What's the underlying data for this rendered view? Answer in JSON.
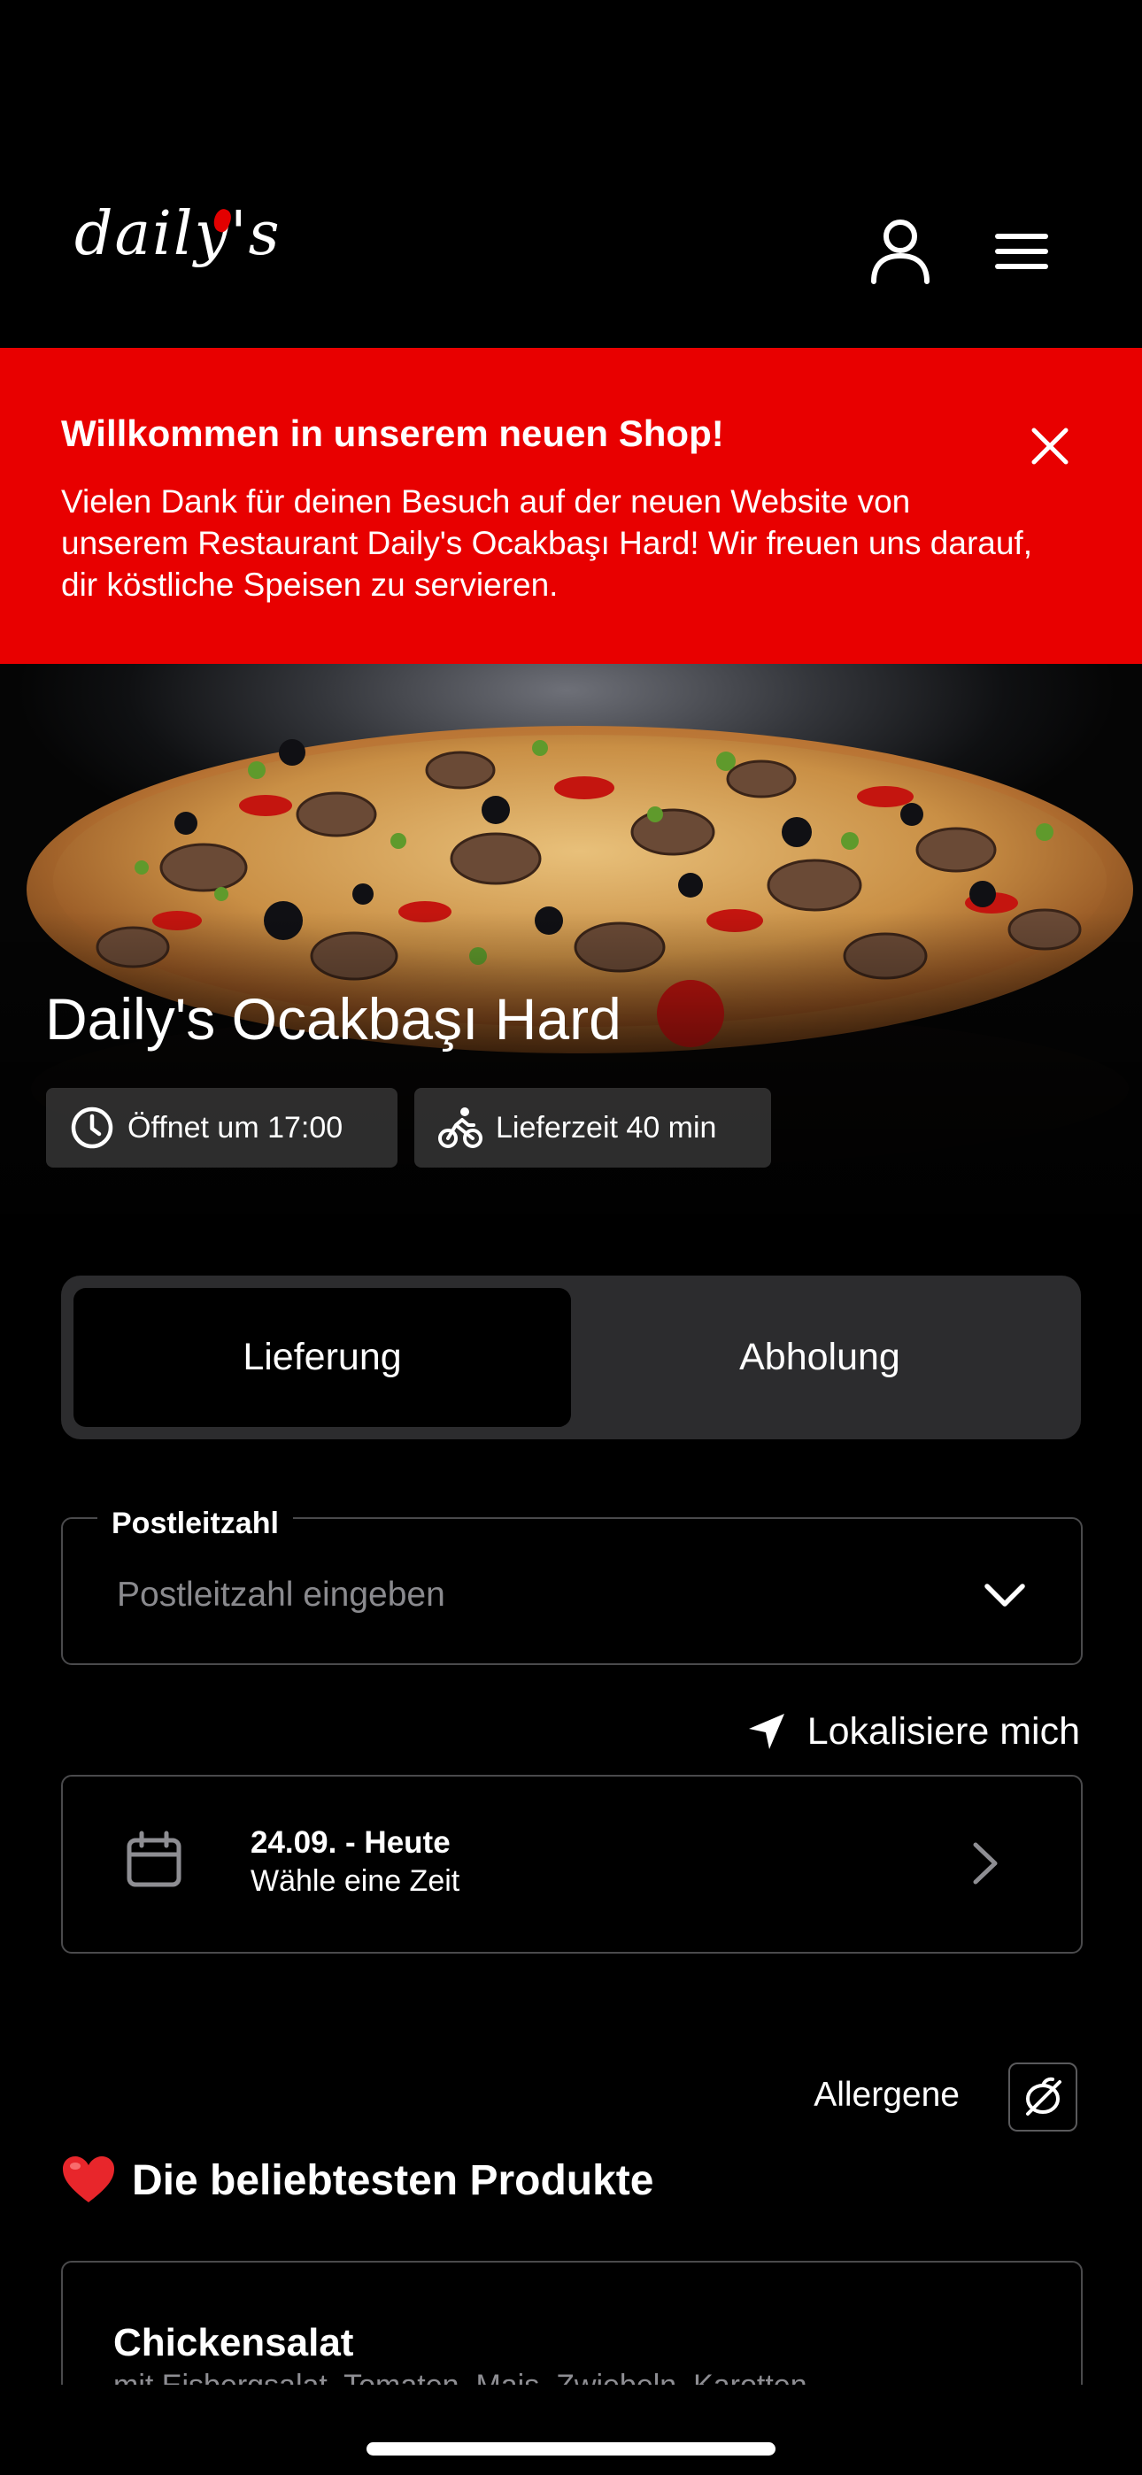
{
  "brand": {
    "logo_text": "daily's",
    "accent_color": "#e80000"
  },
  "header": {
    "account_icon": "user-icon",
    "menu_icon": "hamburger-menu-icon"
  },
  "banner": {
    "title": "Willkommen in unserem neuen Shop!",
    "text": "Vielen Dank für deinen Besuch auf der neuen Website von unserem Restaurant Daily's Ocakbaşı Hard! Wir freuen uns darauf, dir köstliche Speisen zu servieren.",
    "close_icon": "close-icon",
    "background_color": "#e80000"
  },
  "hero": {
    "restaurant_name": "Daily's Ocakbaşı Hard",
    "opening_chip": "Öffnet um 17:00",
    "opening_icon": "clock-icon",
    "delivery_chip": "Lieferzeit 40 min",
    "delivery_icon": "bicycle-icon"
  },
  "order_mode": {
    "options": [
      "Lieferung",
      "Abholung"
    ],
    "selected": "Lieferung"
  },
  "postal_code": {
    "label": "Postleitzahl",
    "placeholder": "Postleitzahl eingeben",
    "value": "",
    "icon": "chevron-down-icon"
  },
  "locate": {
    "label": "Lokalisiere mich",
    "icon": "location-arrow-icon"
  },
  "date_picker": {
    "date": "24.09. - Heute",
    "hint": "Wähle eine Zeit",
    "icon": "calendar-icon"
  },
  "allergens": {
    "label": "Allergene",
    "icon": "allergen-icon"
  },
  "popular": {
    "title": "Die beliebtesten Produkte",
    "icon": "heart-icon",
    "products": [
      {
        "name": "Chickensalat",
        "description": "mit Eisbergsalat, Tomaten, Mais, Zwiebeln, Karotten"
      }
    ]
  }
}
